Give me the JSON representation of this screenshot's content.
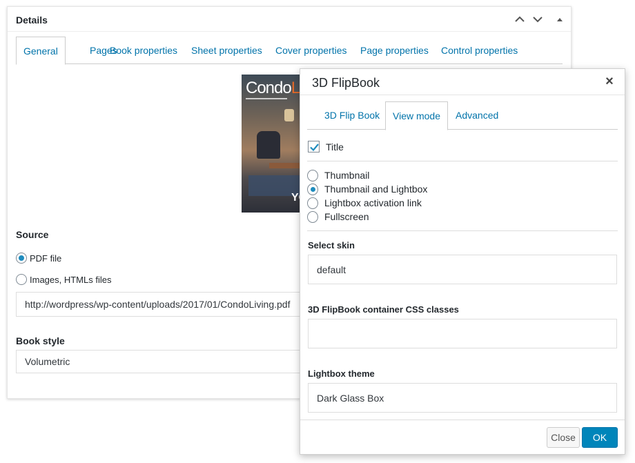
{
  "details": {
    "title": "Details",
    "tabs": [
      "General",
      "Pages",
      "Book properties",
      "Sheet properties",
      "Cover properties",
      "Page properties",
      "Control properties"
    ],
    "cover": {
      "title_white": "Condo",
      "title_orange": "L",
      "corner_text": "YC"
    },
    "source": {
      "label": "Source",
      "options": [
        "PDF file",
        "Images, HTMLs files"
      ],
      "selected": "PDF file",
      "url": "http://wordpress/wp-content/uploads/2017/01/CondoLiving.pdf"
    },
    "book_style": {
      "label": "Book style",
      "value": "Volumetric"
    }
  },
  "dialog": {
    "title": "3D FlipBook",
    "close_glyph": "×",
    "tabs": [
      "3D Flip Book",
      "View mode",
      "Advanced"
    ],
    "active_tab": "View mode",
    "title_checkbox": {
      "label": "Title",
      "checked": true
    },
    "view_modes": [
      "Thumbnail",
      "Thumbnail and Lightbox",
      "Lightbox activation link",
      "Fullscreen"
    ],
    "selected_view_mode": "Thumbnail and Lightbox",
    "skin": {
      "label": "Select skin",
      "value": "default"
    },
    "css_classes": {
      "label": "3D FlipBook container CSS classes",
      "value": ""
    },
    "lightbox_theme": {
      "label": "Lightbox theme",
      "value": "Dark Glass Box"
    },
    "buttons": {
      "close": "Close",
      "ok": "OK"
    }
  },
  "icons": [
    "chevron-up-icon",
    "chevron-down-icon",
    "collapse-triangle-icon",
    "close-icon",
    "checkmark-icon"
  ],
  "colors": {
    "link": "#0073aa",
    "primary_button": "#0085ba",
    "radio_dot": "#1e8cbe"
  }
}
